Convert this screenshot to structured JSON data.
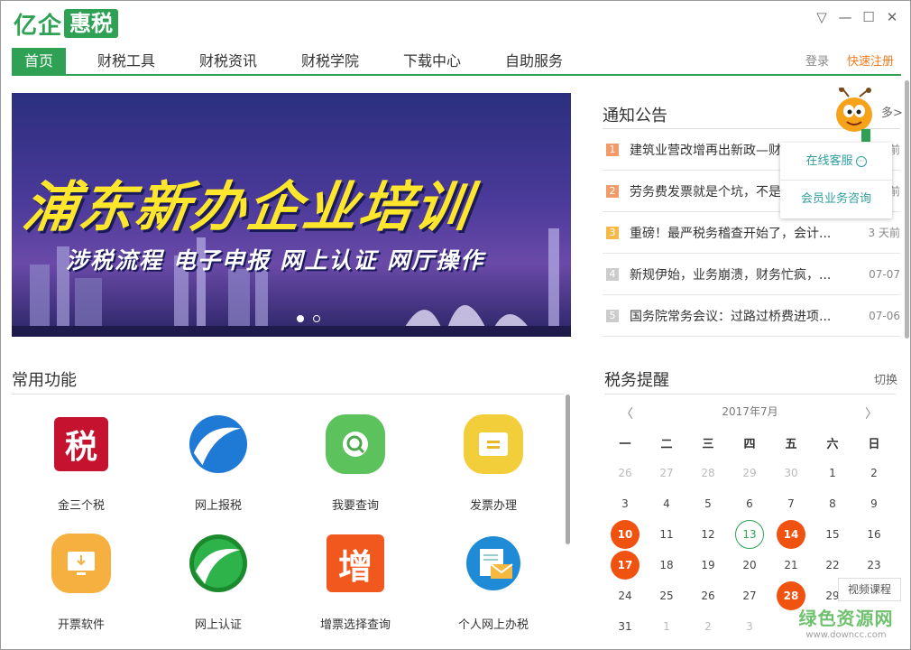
{
  "app": {
    "logo_a": "亿企",
    "logo_b": "惠税"
  },
  "window": {
    "menu_icon": "▽",
    "min_icon": "—",
    "max_icon": "☐",
    "close_icon": "✕"
  },
  "nav": {
    "tabs": [
      "首页",
      "财税工具",
      "财税资讯",
      "财税学院",
      "下载中心",
      "自助服务"
    ],
    "login": "登录",
    "register": "快速注册"
  },
  "banner": {
    "title": "浦东新办企业培训",
    "subtitle": "涉税流程 电子申报 网上认证 网厅操作",
    "slides": 2,
    "active_slide": 0
  },
  "notices": {
    "title": "通知公告",
    "more": "多>",
    "items": [
      {
        "num": "1",
        "text": "建筑业营改增再出新政—财",
        "date": "前"
      },
      {
        "num": "2",
        "text": "劳务费发票就是个坑，不是",
        "date": "前"
      },
      {
        "num": "3",
        "text": "重磅！最严税务稽查开始了，会计...",
        "date": "3 天前"
      },
      {
        "num": "4",
        "text": "新规伊始，业务崩溃，财务忙疯，...",
        "date": "07-07"
      },
      {
        "num": "5",
        "text": "国务院常务会议：过路过桥费进项...",
        "date": "07-06"
      }
    ],
    "num_colors": [
      "#f29a6a",
      "#f29a6a",
      "#f5b94a",
      "#cccccc",
      "#cccccc"
    ]
  },
  "service": {
    "online": "在线客服",
    "member": "会员业务咨询"
  },
  "functions": {
    "title": "常用功能",
    "items": [
      {
        "label": "金三个税",
        "icon": "tax-char-icon",
        "glyph": "税"
      },
      {
        "label": "网上报税",
        "icon": "wave-icon",
        "glyph": ""
      },
      {
        "label": "我要查询",
        "icon": "search-icon",
        "glyph": ""
      },
      {
        "label": "发票办理",
        "icon": "ticket-icon",
        "glyph": ""
      },
      {
        "label": "开票软件",
        "icon": "monitor-download-icon",
        "glyph": ""
      },
      {
        "label": "网上认证",
        "icon": "globe-wave-icon",
        "glyph": ""
      },
      {
        "label": "增票选择查询",
        "icon": "zeng-char-icon",
        "glyph": "增"
      },
      {
        "label": "个人网上办税",
        "icon": "mail-doc-icon",
        "glyph": ""
      }
    ]
  },
  "tax_reminder": {
    "title": "税务提醒",
    "switch": "切换",
    "month": "2017年7月",
    "prev": "〈",
    "next": "〉",
    "weekdays": [
      "一",
      "二",
      "三",
      "四",
      "五",
      "六",
      "日"
    ],
    "weeks": [
      [
        "26",
        "27",
        "28",
        "29",
        "30",
        "1",
        "2"
      ],
      [
        "3",
        "4",
        "5",
        "6",
        "7",
        "8",
        "9"
      ],
      [
        "10",
        "11",
        "12",
        "13",
        "14",
        "15",
        "16"
      ],
      [
        "17",
        "18",
        "19",
        "20",
        "21",
        "22",
        "23"
      ],
      [
        "24",
        "25",
        "26",
        "27",
        "28",
        "29",
        "30"
      ],
      [
        "31",
        "1",
        "2",
        "3",
        "",
        "",
        ""
      ]
    ],
    "highlighted": [
      "10",
      "14",
      "17",
      "28"
    ],
    "today": "13"
  },
  "video_course": "视频课程",
  "watermark": {
    "big": "绿色资源网",
    "small": "www.downcc.com"
  }
}
